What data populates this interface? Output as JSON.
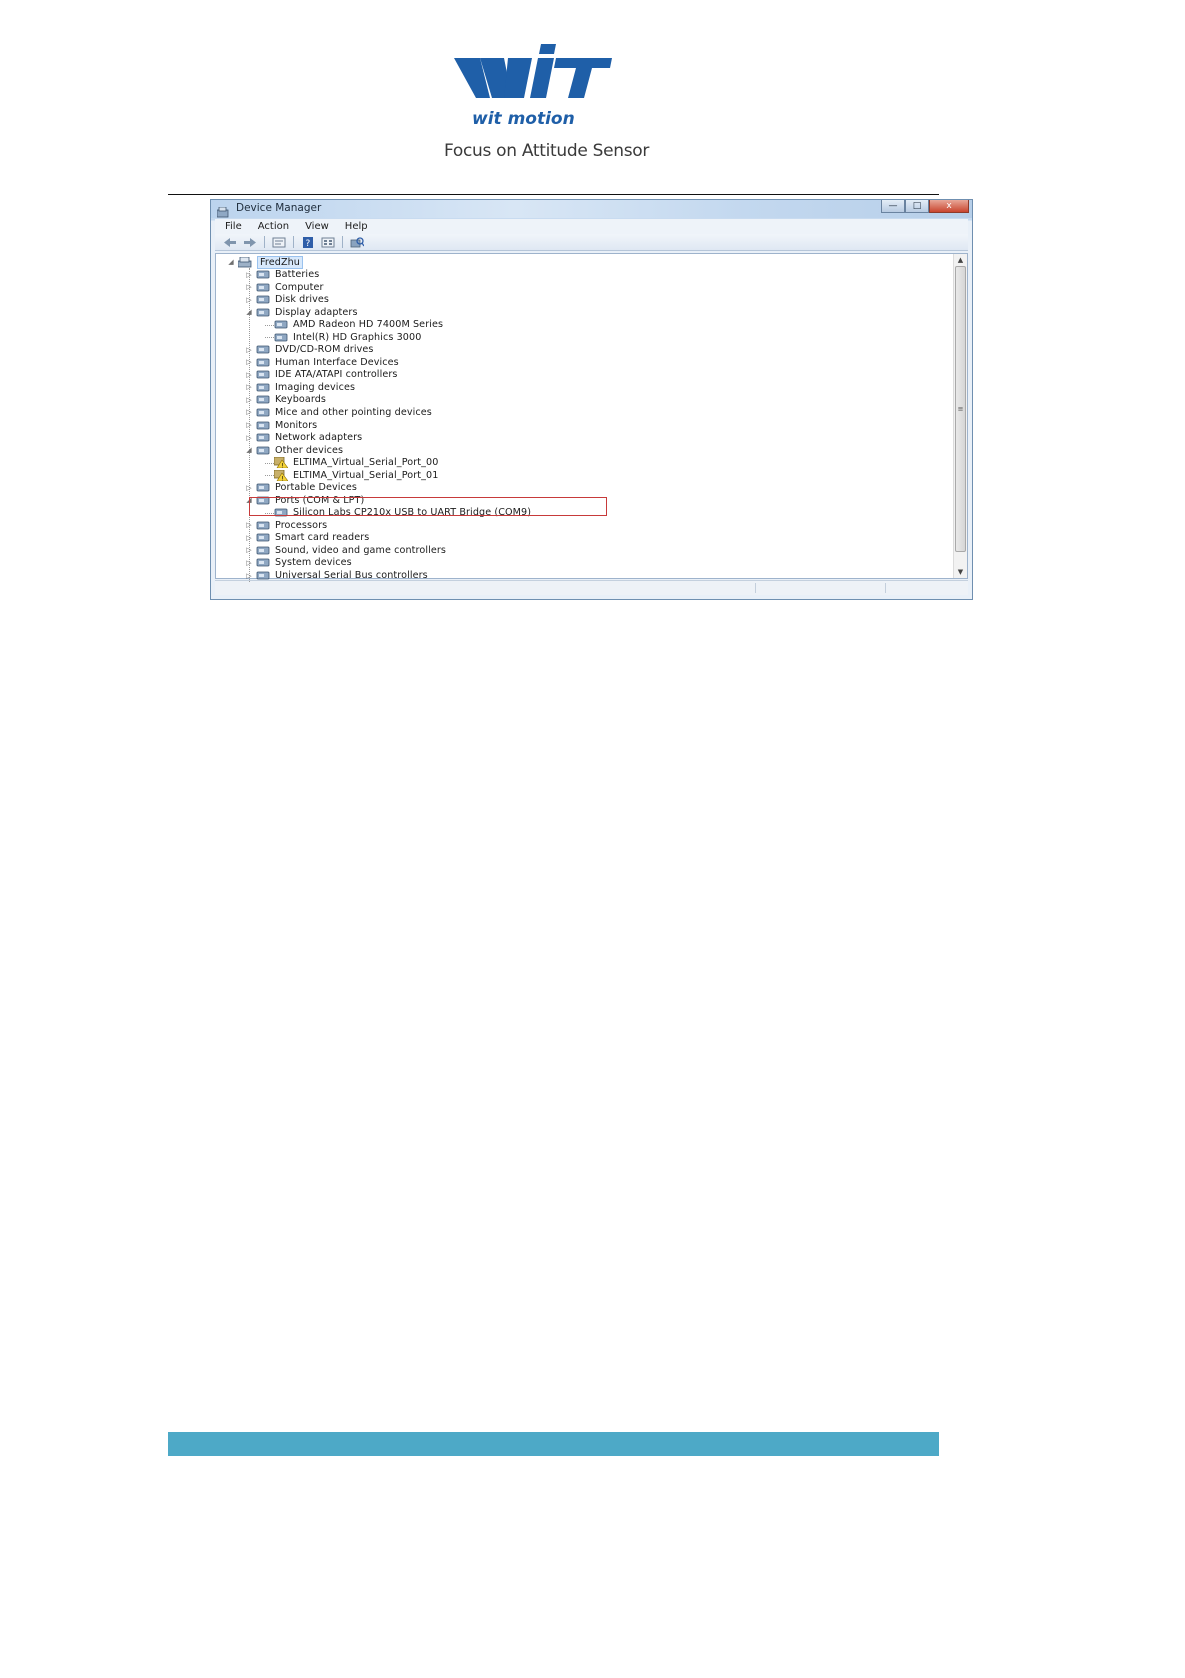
{
  "brand": {
    "logo_text": "WIT",
    "logo_subtext": "wit motion",
    "tagline": "Focus on Attitude Sensor",
    "logo_color": "#1f5fa8",
    "footer_color": "#4da9c7"
  },
  "window": {
    "title": "Device Manager",
    "buttons": {
      "minimize": "—",
      "maximize": "□",
      "close": "x"
    },
    "menu": [
      "File",
      "Action",
      "View",
      "Help"
    ],
    "toolbar_icons": [
      "back-icon",
      "forward-icon",
      "properties-icon",
      "help-icon",
      "view-icon",
      "scan-hardware-icon"
    ],
    "scrollbar": {
      "up": "▲",
      "grip": "≡",
      "down": "▼"
    }
  },
  "tree": {
    "root": "FredZhu",
    "items": [
      {
        "label": "Batteries",
        "toggle": "▷",
        "icon": "battery-icon"
      },
      {
        "label": "Computer",
        "toggle": "▷",
        "icon": "computer-icon"
      },
      {
        "label": "Disk drives",
        "toggle": "▷",
        "icon": "disk-drive-icon"
      },
      {
        "label": "Display adapters",
        "toggle": "◢",
        "icon": "display-adapter-icon"
      },
      {
        "label": "AMD Radeon HD 7400M Series",
        "child": true,
        "icon": "display-adapter-icon"
      },
      {
        "label": "Intel(R) HD Graphics 3000",
        "child": true,
        "icon": "display-adapter-icon"
      },
      {
        "label": "DVD/CD-ROM drives",
        "toggle": "▷",
        "icon": "dvd-drive-icon"
      },
      {
        "label": "Human Interface Devices",
        "toggle": "▷",
        "icon": "hid-icon"
      },
      {
        "label": "IDE ATA/ATAPI controllers",
        "toggle": "▷",
        "icon": "ide-controller-icon"
      },
      {
        "label": "Imaging devices",
        "toggle": "▷",
        "icon": "camera-icon"
      },
      {
        "label": "Keyboards",
        "toggle": "▷",
        "icon": "keyboard-icon"
      },
      {
        "label": "Mice and other pointing devices",
        "toggle": "▷",
        "icon": "mouse-icon"
      },
      {
        "label": "Monitors",
        "toggle": "▷",
        "icon": "monitor-icon"
      },
      {
        "label": "Network adapters",
        "toggle": "▷",
        "icon": "network-adapter-icon"
      },
      {
        "label": "Other devices",
        "toggle": "◢",
        "icon": "other-device-icon"
      },
      {
        "label": "ELTIMA_Virtual_Serial_Port_00",
        "child": true,
        "icon": "warning-device-icon"
      },
      {
        "label": "ELTIMA_Virtual_Serial_Port_01",
        "child": true,
        "icon": "warning-device-icon"
      },
      {
        "label": "Portable Devices",
        "toggle": "▷",
        "icon": "portable-device-icon"
      },
      {
        "label": "Ports (COM & LPT)",
        "toggle": "◢",
        "icon": "port-icon"
      },
      {
        "label": "Silicon Labs CP210x USB to UART Bridge (COM9)",
        "child": true,
        "icon": "port-icon"
      },
      {
        "label": "Processors",
        "toggle": "▷",
        "icon": "processor-icon"
      },
      {
        "label": "Smart card readers",
        "toggle": "▷",
        "icon": "smart-card-icon"
      },
      {
        "label": "Sound, video and game controllers",
        "toggle": "▷",
        "icon": "sound-icon"
      },
      {
        "label": "System devices",
        "toggle": "▷",
        "icon": "system-device-icon"
      },
      {
        "label": "Universal Serial Bus controllers",
        "toggle": "▷",
        "icon": "usb-icon"
      }
    ]
  },
  "highlight_color": "#c73a3a"
}
